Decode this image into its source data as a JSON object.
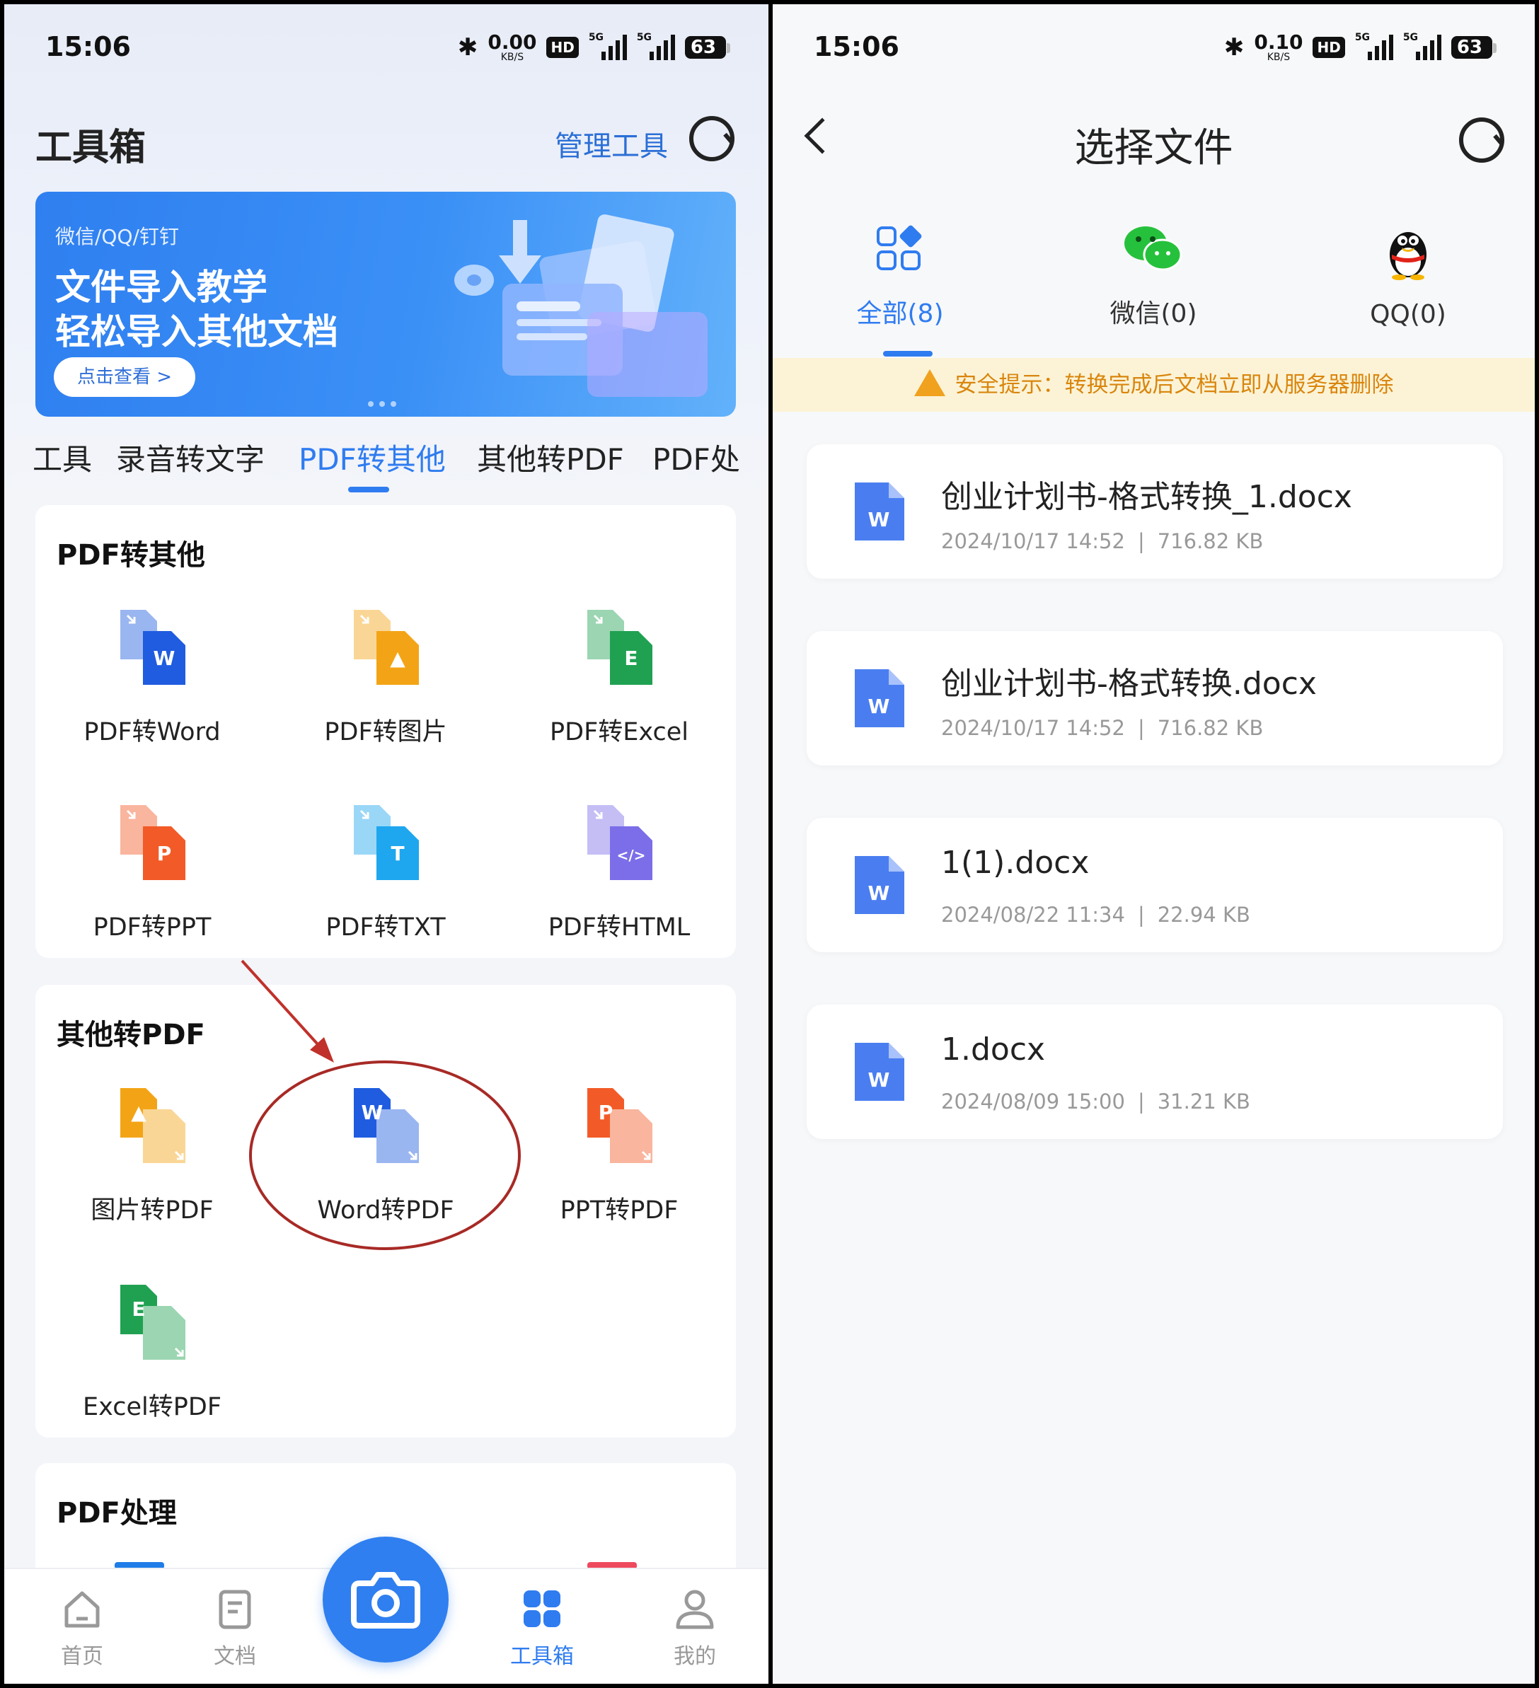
{
  "status_left": {
    "time": "15:06",
    "speed_value": "0.00",
    "speed_unit": "KB/S",
    "hd": "HD",
    "sig1": "5G",
    "sig2": "5G",
    "battery": "63"
  },
  "status_right": {
    "time": "15:06",
    "speed_value": "0.10",
    "speed_unit": "KB/S",
    "hd": "HD",
    "sig1": "5G",
    "sig2": "5G",
    "battery": "63"
  },
  "left": {
    "title": "工具箱",
    "manage": "管理工具",
    "banner": {
      "small": "微信/QQ/钉钉",
      "line1": "文件导入教学",
      "line2": "轻松导入其他文档",
      "button": "点击查看 >"
    },
    "tabs": [
      {
        "label": "工具"
      },
      {
        "label": "录音转文字"
      },
      {
        "label": "PDF转其他"
      },
      {
        "label": "其他转PDF"
      },
      {
        "label": "PDF处"
      }
    ],
    "active_tab_index": 2,
    "sections": [
      {
        "title": "PDF转其他",
        "tools": [
          {
            "label": "PDF转Word",
            "icon": "pdf-to-word-icon",
            "badge": "W",
            "color": "#1f5ce0"
          },
          {
            "label": "PDF转图片",
            "icon": "pdf-to-image-icon",
            "badge": "▲",
            "color": "#f3a416"
          },
          {
            "label": "PDF转Excel",
            "icon": "pdf-to-excel-icon",
            "badge": "E",
            "color": "#20a152"
          },
          {
            "label": "PDF转PPT",
            "icon": "pdf-to-ppt-icon",
            "badge": "P",
            "color": "#f25b27"
          },
          {
            "label": "PDF转TXT",
            "icon": "pdf-to-txt-icon",
            "badge": "T",
            "color": "#1ea7ee"
          },
          {
            "label": "PDF转HTML",
            "icon": "pdf-to-html-icon",
            "badge": "</>",
            "color": "#7b6ee8"
          }
        ]
      },
      {
        "title": "其他转PDF",
        "tools": [
          {
            "label": "图片转PDF",
            "icon": "image-to-pdf-icon",
            "badge": "▲",
            "color": "#f3a416"
          },
          {
            "label": "Word转PDF",
            "icon": "word-to-pdf-icon",
            "badge": "W",
            "color": "#1f5ce0"
          },
          {
            "label": "PPT转PDF",
            "icon": "ppt-to-pdf-icon",
            "badge": "P",
            "color": "#f25b27"
          },
          {
            "label": "Excel转PDF",
            "icon": "excel-to-pdf-icon",
            "badge": "E",
            "color": "#20a152"
          }
        ]
      },
      {
        "title": "PDF处理"
      }
    ],
    "bottom_nav": [
      {
        "label": "首页",
        "icon": "home-icon"
      },
      {
        "label": "文档",
        "icon": "document-icon"
      },
      {
        "label": "工具箱",
        "icon": "toolbox-grid-icon",
        "active": true
      },
      {
        "label": "我的",
        "icon": "profile-icon"
      }
    ],
    "accent": "#2f7cf0"
  },
  "right": {
    "title": "选择文件",
    "source_tabs": [
      {
        "label": "全部(8)",
        "icon": "all-files-icon",
        "active": true
      },
      {
        "label": "微信(0)",
        "icon": "wechat-icon"
      },
      {
        "label": "QQ(0)",
        "icon": "qq-penguin-icon"
      }
    ],
    "notice": "安全提示：转换完成后文档立即从服务器删除",
    "files": [
      {
        "name": "创业计划书-格式转换_1.docx",
        "date": "2024/10/17 14:52",
        "size": "716.82 KB"
      },
      {
        "name": "创业计划书-格式转换.docx",
        "date": "2024/10/17 14:52",
        "size": "716.82 KB"
      },
      {
        "name": "1(1).docx",
        "date": "2024/08/22 11:34",
        "size": "22.94 KB"
      },
      {
        "name": "1.docx",
        "date": "2024/08/09 15:00",
        "size": "31.21 KB"
      }
    ],
    "file_badge": "W"
  }
}
